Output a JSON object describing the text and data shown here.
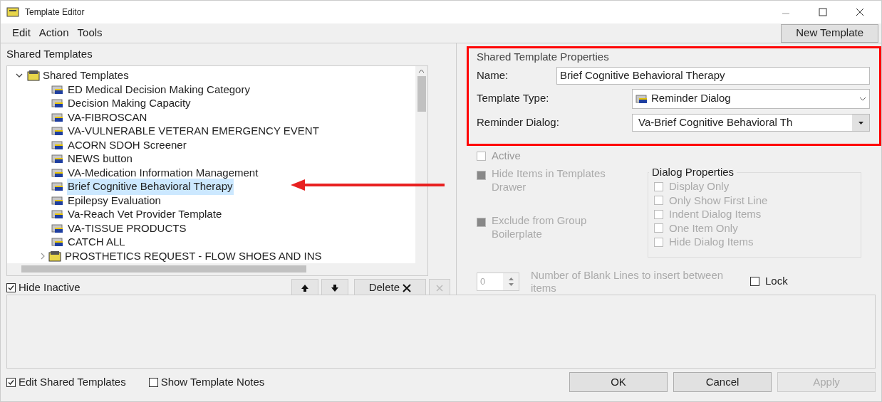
{
  "window": {
    "title": "Template Editor"
  },
  "menu": [
    "Edit",
    "Action",
    "Tools"
  ],
  "toolbar": {
    "new_template": "New Template"
  },
  "left_pane": {
    "title": "Shared Templates",
    "tree": {
      "label": "Shared Templates",
      "expanded": true,
      "children": [
        {
          "label": "ED Medical Decision Making Category",
          "kind": "template",
          "selected": false
        },
        {
          "label": "Decision Making Capacity",
          "kind": "template",
          "selected": false
        },
        {
          "label": "VA-FIBROSCAN",
          "kind": "template",
          "selected": false
        },
        {
          "label": "VA-VULNERABLE VETERAN EMERGENCY EVENT",
          "kind": "template",
          "selected": false
        },
        {
          "label": "ACORN SDOH Screener",
          "kind": "template",
          "selected": false
        },
        {
          "label": "NEWS button",
          "kind": "template",
          "selected": false
        },
        {
          "label": "VA-Medication Information Management",
          "kind": "template",
          "selected": false
        },
        {
          "label": "Brief Cognitive Behavioral Therapy",
          "kind": "template",
          "selected": true
        },
        {
          "label": "Epilepsy Evaluation",
          "kind": "template",
          "selected": false
        },
        {
          "label": "Va-Reach Vet Provider Template",
          "kind": "template",
          "selected": false
        },
        {
          "label": "VA-TISSUE PRODUCTS",
          "kind": "template",
          "selected": false
        },
        {
          "label": "CATCH ALL",
          "kind": "template",
          "selected": false
        },
        {
          "label": "PROSTHETICS REQUEST - FLOW SHOES AND INS",
          "kind": "group",
          "expanded": false,
          "selected": false
        }
      ]
    },
    "hide_inactive": {
      "label": "Hide Inactive",
      "checked": true
    },
    "delete_button": "Delete"
  },
  "properties": {
    "title": "Shared Template Properties",
    "name": {
      "label": "Name:",
      "value": "Brief Cognitive Behavioral Therapy"
    },
    "template_type": {
      "label": "Template Type:",
      "value": "Reminder Dialog"
    },
    "reminder_dialog": {
      "label": "Reminder Dialog:",
      "value": "Va-Brief Cognitive Behavioral Th"
    },
    "active": {
      "label": "Active",
      "checked": false
    },
    "hide_items": {
      "label": "Hide Items in Templates Drawer",
      "checked": true,
      "disabled": true
    },
    "exclude": {
      "label": "Exclude from Group Boilerplate",
      "checked": true,
      "disabled": true
    },
    "dialog_properties": {
      "title": "Dialog Properties",
      "options": [
        {
          "label": "Display Only",
          "checked": false
        },
        {
          "label": "Only Show First Line",
          "checked": false
        },
        {
          "label": "Indent Dialog Items",
          "checked": false
        },
        {
          "label": "One Item Only",
          "checked": false
        },
        {
          "label": "Hide Dialog Items",
          "checked": false
        }
      ]
    },
    "blank_lines": {
      "value": "0",
      "label": "Number of Blank Lines to insert between items"
    },
    "lock": {
      "label": "Lock",
      "checked": false
    }
  },
  "footer": {
    "edit_shared": {
      "label": "Edit Shared Templates",
      "checked": true
    },
    "show_notes": {
      "label": "Show Template Notes",
      "checked": false
    },
    "buttons": [
      {
        "label": "OK",
        "disabled": false
      },
      {
        "label": "Cancel",
        "disabled": false
      },
      {
        "label": "Apply",
        "disabled": true
      }
    ]
  }
}
